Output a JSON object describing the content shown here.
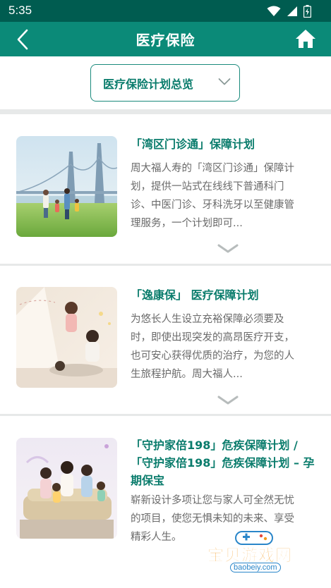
{
  "status_bar": {
    "time": "5:35",
    "icons": [
      "wifi-icon",
      "signal-icon",
      "battery-icon"
    ]
  },
  "header": {
    "title": "医疗保险",
    "back_icon": "back-arrow-icon",
    "home_icon": "home-icon"
  },
  "filter": {
    "selected": "医疗保险计划总览",
    "icon": "chevron-down-icon"
  },
  "plans": [
    {
      "title": "「湾区门诊通」保障计划",
      "description": "周大福人寿的「湾区门诊通」保障计划，提供一站式在线线下普通科门诊、中医门诊、牙科洗牙以至健康管理服务，一个计划即可..."
    },
    {
      "title": "「逸康保」 医疗保障计划",
      "description": "为悠长人生设立充裕保障必须要及时，即使出现突发的高昂医疗开支，也可安心获得优质的治疗，为您的人生旅程护航。周大福人..."
    },
    {
      "title": "「守护家倍198」危疾保障计划 / 「守护家倍198」危疾保障计划 – 孕期保宝",
      "description": "崭新设计多项让您与家人可全然无忧的项目，使您无惧未知的未来、享受精彩人生。"
    }
  ],
  "watermark": {
    "text": "宝贝游戏网",
    "url": "baobeiy.com"
  },
  "colors": {
    "status_bar": "#005c50",
    "app_bar": "#0b8a78",
    "accent_text": "#0a7c6c",
    "body_text": "#6a6a6a",
    "divider": "#e7e9e9"
  }
}
